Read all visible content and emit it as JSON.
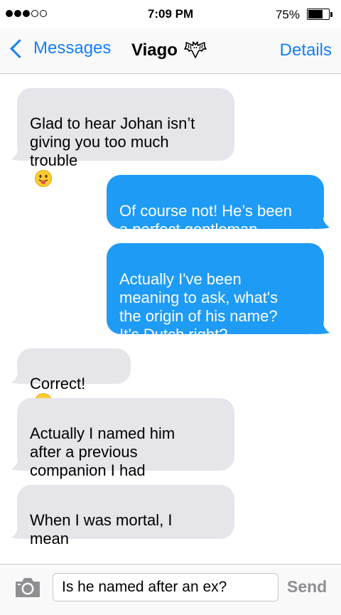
{
  "status_bar": {
    "signal_bars_filled": 3,
    "signal_bars_total": 5,
    "time": "7:09 PM",
    "battery_percent": "75%",
    "battery_level": 0.75
  },
  "navbar": {
    "back_label": "Messages",
    "contact_name": "Viago",
    "contact_icon": "bat-icon",
    "details_label": "Details",
    "accent_color": "#157efb"
  },
  "messages": [
    {
      "direction": "incoming",
      "text": "Glad to hear Johan isn’t\ngiving you too much\ntrouble",
      "emoji": "tongue-out-face-emoji"
    },
    {
      "direction": "outgoing",
      "text": "Of course not! He’s been\na perfect gentleman"
    },
    {
      "direction": "outgoing",
      "text": "Actually I've been\nmeaning to ask, what's\nthe origin of his name?\nIt’s Dutch right?"
    },
    {
      "direction": "incoming",
      "text": "Correct!",
      "emoji": "slightly-smiling-face-emoji"
    },
    {
      "direction": "incoming",
      "text": "Actually I named him\nafter a previous\ncompanion I had"
    },
    {
      "direction": "incoming",
      "text": "When I was mortal, I\nmean"
    }
  ],
  "composer": {
    "input_value": "Is he named after an ex?",
    "send_label": "Send",
    "camera_icon": "camera-icon"
  },
  "colors": {
    "incoming_bubble": "#e5e5ea",
    "outgoing_bubble": "#1e9bf5",
    "send_disabled": "#8e8e93"
  }
}
